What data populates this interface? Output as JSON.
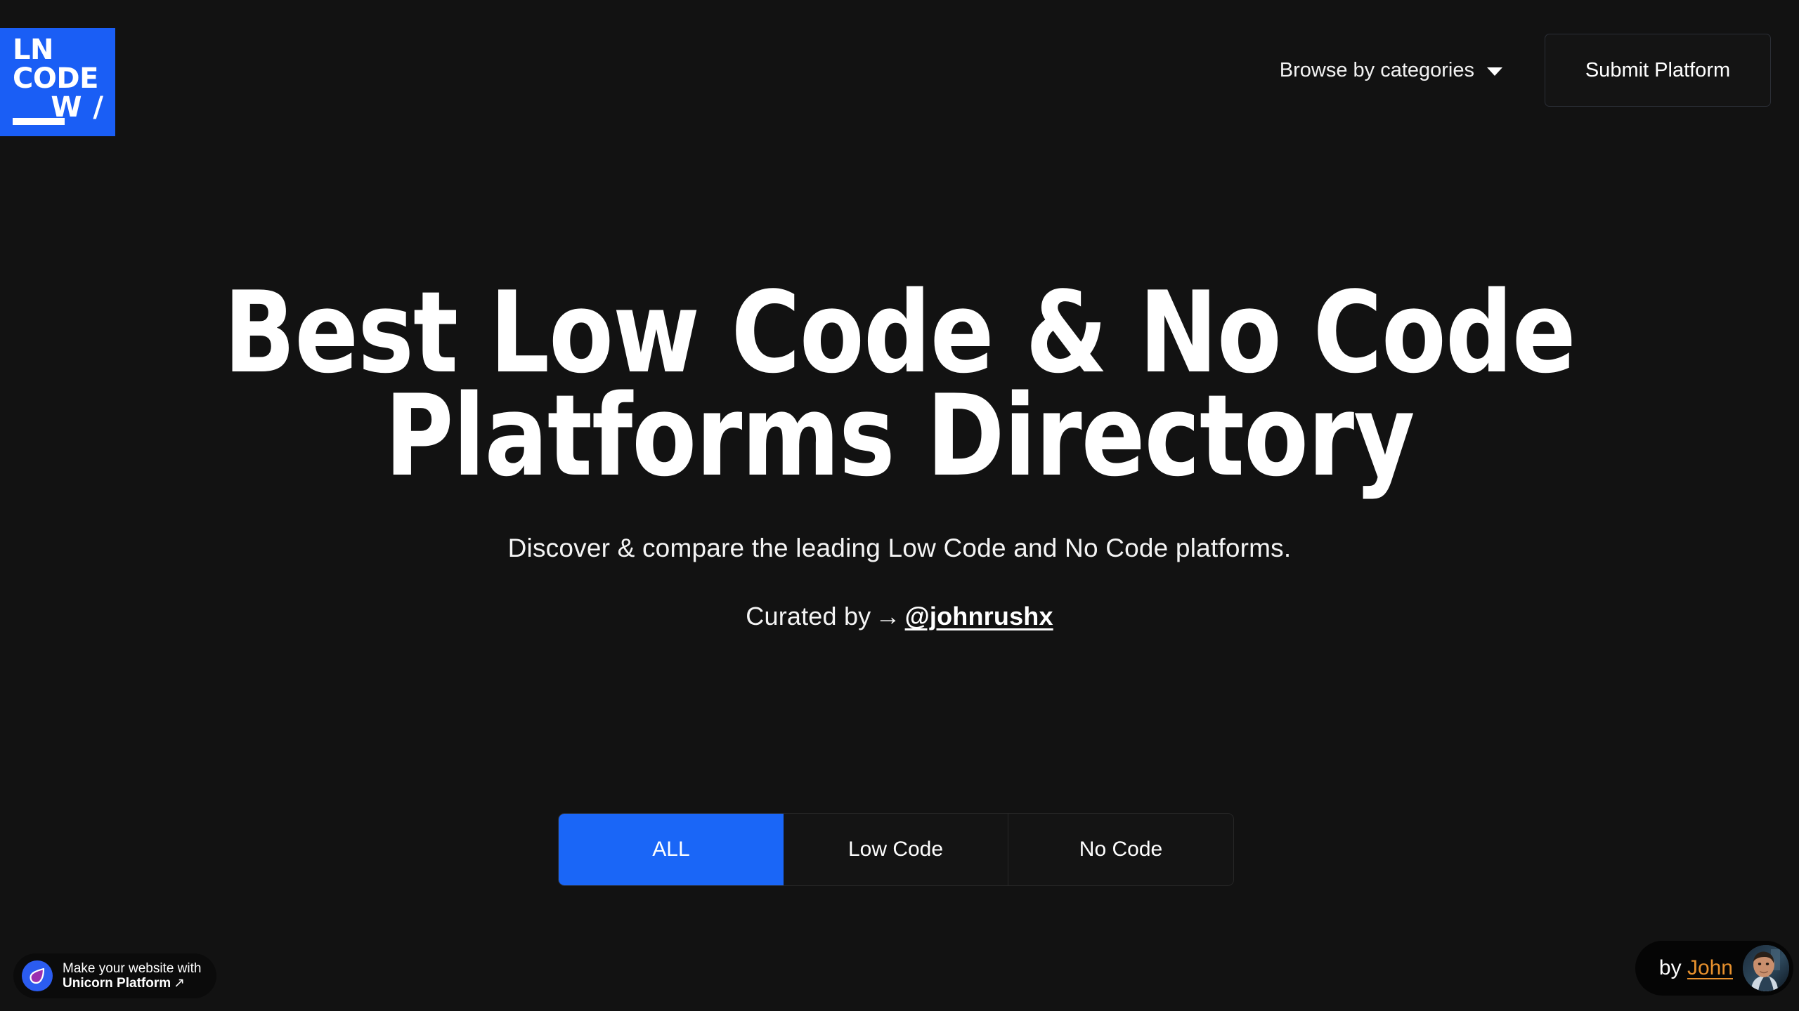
{
  "theme": {
    "background": "#121212",
    "accent_blue": "#1a5ef5",
    "tab_active_blue": "#1a66f7",
    "text": "#ffffff",
    "border": "#2b2e36",
    "john_orange": "#e8912d"
  },
  "header": {
    "logo": {
      "line1": "LN",
      "line2": "CODE",
      "line3": "W /",
      "alt": "LN Code W logo"
    },
    "browse_label": "Browse by categories",
    "caret_icon": "chevron-down-icon",
    "submit_label": "Submit Platform"
  },
  "hero": {
    "title_line1": "Best Low Code & No Code",
    "title_line2": "Platforms Directory",
    "subtitle": "Discover & compare the leading Low Code and No Code platforms.",
    "curated_prefix": "Curated by",
    "curated_arrow": "→",
    "curated_handle": "@johnrushx"
  },
  "filters": {
    "tabs": [
      {
        "label": "ALL",
        "active": true
      },
      {
        "label": "Low Code",
        "active": false
      },
      {
        "label": "No Code",
        "active": false
      }
    ]
  },
  "badges": {
    "unicorn": {
      "line1": "Make your website with",
      "line2": "Unicorn Platform",
      "external_icon": "↗",
      "logo_icon": "unicorn-droplet-icon"
    },
    "john": {
      "prefix": "by",
      "name": "John",
      "avatar_icon": "avatar-photo"
    }
  }
}
